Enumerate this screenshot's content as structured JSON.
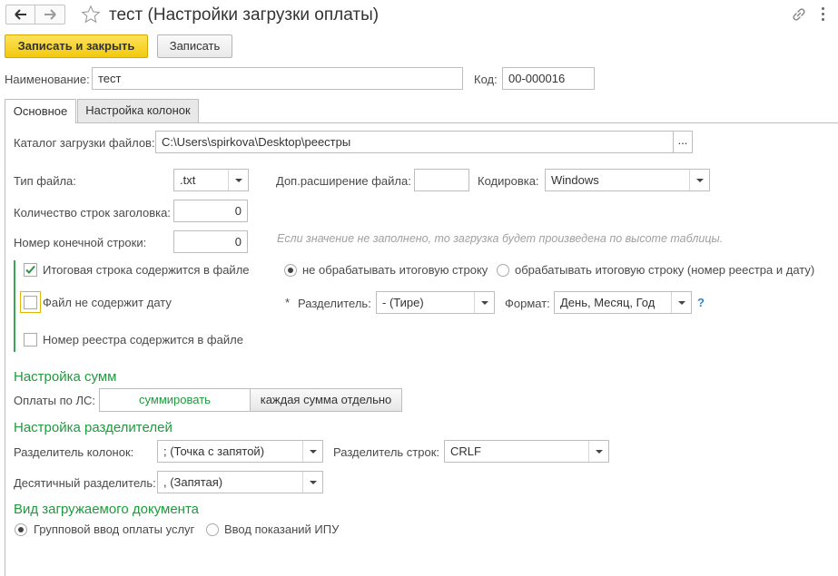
{
  "window": {
    "title": "тест (Настройки загрузки оплаты)"
  },
  "toolbar": {
    "save_close_label": "Записать и закрыть",
    "save_label": "Записать"
  },
  "header": {
    "name_label": "Наименование:",
    "name_value": "тест",
    "code_label": "Код:",
    "code_value": "00-000016"
  },
  "tabs": [
    {
      "label": "Основное",
      "active": true
    },
    {
      "label": "Настройка колонок",
      "active": false
    }
  ],
  "main": {
    "catalog_label": "Каталог загрузки файлов:",
    "catalog_value": "C:\\Users\\spirkova\\Desktop\\реестры",
    "catalog_btn": "...",
    "file_type_label": "Тип файла:",
    "file_type_value": ".txt",
    "ext_label": "Доп.расширение файла:",
    "ext_value": "",
    "encoding_label": "Кодировка:",
    "encoding_value": "Windows",
    "header_rows_label": "Количество строк заголовка:",
    "header_rows_value": "0",
    "end_row_label": "Номер конечной строки:",
    "end_row_value": "0",
    "end_row_hint": "Если значение не заполнено, то загрузка будет произведена по высоте таблицы.",
    "total_row_label": "Итоговая строка содержится в файле",
    "total_row_checked": true,
    "radio_no_total": "не обрабатывать итоговую строку",
    "radio_total": "обрабатывать итоговую строку (номер реестра и дату)",
    "no_date_label": "Файл не содержит дату",
    "no_date_checked": false,
    "separator_required": "*",
    "separator_label": "Разделитель:",
    "separator_value": "- (Тире)",
    "format_label": "Формат:",
    "format_value": "День, Месяц, Год",
    "help": "?",
    "registry_no_label": "Номер реестра содержится в файле",
    "registry_no_checked": false
  },
  "sums": {
    "title": "Настройка сумм",
    "ls_label": "Оплаты по ЛС:",
    "opt_sum": "суммировать",
    "opt_each": "каждая сумма отдельно"
  },
  "separators": {
    "title": "Настройка разделителей",
    "col_label": "Разделитель колонок:",
    "col_value": "; (Точка с запятой)",
    "row_label": "Разделитель строк:",
    "row_value": "CRLF",
    "dec_label": "Десятичный разделитель:",
    "dec_value": ", (Запятая)"
  },
  "doc_type": {
    "title": "Вид загружаемого документа",
    "opt_group": "Групповой ввод оплаты услуг",
    "opt_meter": "Ввод показаний ИПУ"
  },
  "colors": {
    "accent_yellow": "#f7d31a",
    "section_green": "#1f9a3e",
    "help_blue": "#2e86c9"
  }
}
